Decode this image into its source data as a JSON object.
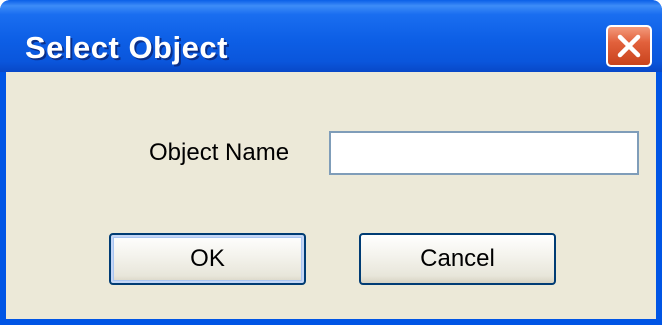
{
  "window": {
    "title": "Select Object",
    "close_icon": "close-icon"
  },
  "form": {
    "object_name_label": "Object Name",
    "object_name_value": ""
  },
  "buttons": {
    "ok_label": "OK",
    "cancel_label": "Cancel"
  },
  "colors": {
    "titlebar": "#0a56dc",
    "client_background": "#ece9d8",
    "close_button": "#e2613c",
    "button_border": "#003c74"
  }
}
